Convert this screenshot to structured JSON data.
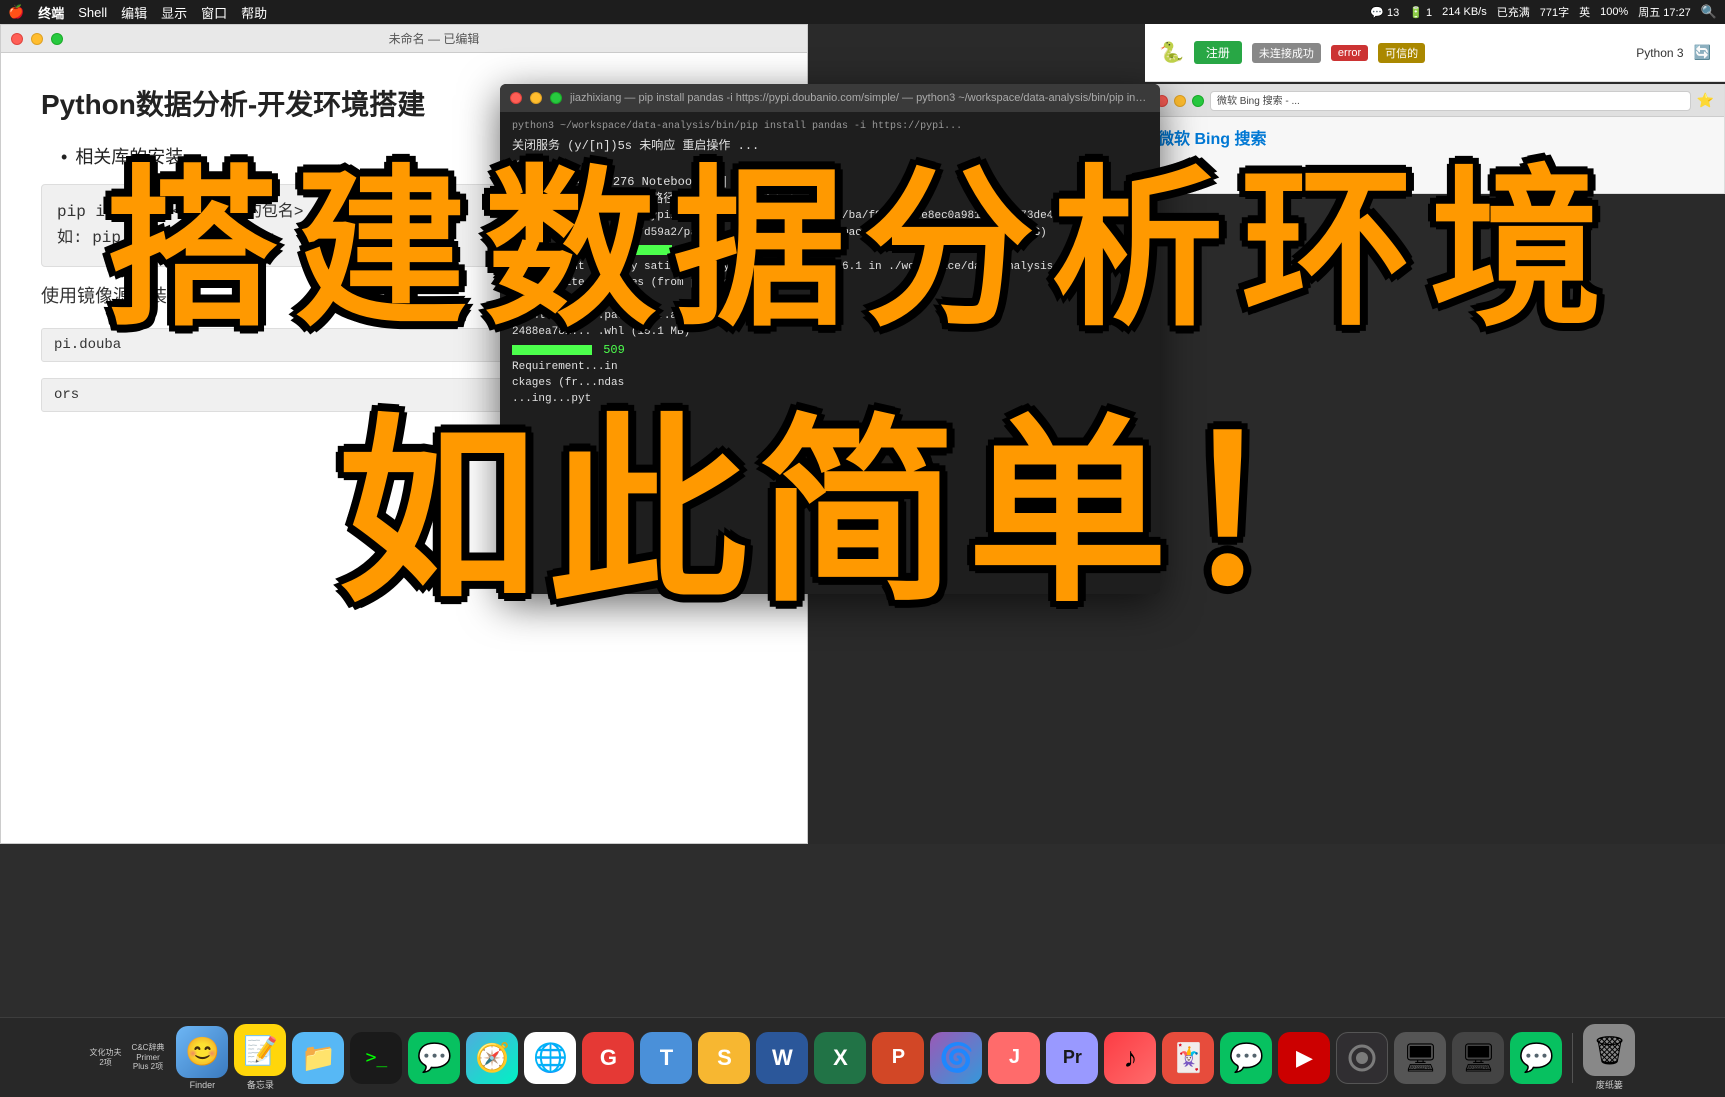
{
  "menubar": {
    "apple": "🍎",
    "items": [
      "终端",
      "Shell",
      "编辑",
      "显示",
      "窗口",
      "帮助"
    ],
    "right_items": [
      "📶 13",
      "🔋 1",
      "214 KB/s",
      "已充满",
      "771字",
      "英",
      "100% 🔋",
      "周五 17:27",
      "🔍"
    ]
  },
  "left_window": {
    "title": "未命名 — 已编辑",
    "slide": {
      "title": "Python数据分析-开发环境搭建",
      "bullet1": "相关库的安装",
      "code_line1": "pip install <你要安装的包名>",
      "code_line2": "如: pip install jupyter",
      "source_label": "使用镜像源安装：",
      "url1": "pi.douba",
      "url2": "ors"
    }
  },
  "terminal_window": {
    "title": "jiazhixiang — pip install pandas -i https://pypi.doubanio.com/simple/ — python3 ~/workspace/data-analysis/bin/pip install...",
    "subtitle": "python3 ~/workspace/data-analysis/bin/pip install pandas -i https://pypi...",
    "lines": [
      "关闭服务 (y/[n])5s 未响应 重启操作 ...",
      "y",
      "^C[1 17:24:52.276 NotebookApp] 中断",
      "启动 notebooks 在本地路径：/Users/jiazhixiang",
      "Downloading https://pypi.doubanio.com/packages/ab/ba/f97030b7e8ec0a981abdca173de4e72/b3a",
      "7b4ed5dba492f362ba87d59a2/pandas-1.0.1-cp37-cp37m-macosx_10_9_x86_64.whl (9.8 MB)",
      "[GREEN_BAR] 9.8 MB 596 kB/s",
      "Requirement already satisfied: python-dateutil>=2.6.1 in ./workspace/data-analysis/lib/pyt",
      "hon3.7/site-packages (from pandas) (2.8.1)",
      "Collecting...",
      "Downloading...package...a8d2c1e4a2cbf1",
      "2488ea781... .whl (15.1 MB)",
      "[GREEN_BAR2] 509",
      "Requirement...in",
      "ckages (fr...ndas",
      "...ing...pyt"
    ]
  },
  "overlay": {
    "top_text": "搭建数据分析环境",
    "bottom_text": "如此简单！"
  },
  "dock": {
    "items": [
      {
        "label": "文化功夫\n2项",
        "icon": "📝",
        "color": "#e8e8e8"
      },
      {
        "label": "C&C辞典 Primer\nPlus 2项",
        "icon": "📚",
        "color": "#e8e8e8"
      },
      {
        "label": "Finder",
        "icon": "😊",
        "color": "#6db6f5"
      },
      {
        "label": "备忘录",
        "icon": "📋",
        "color": "#ffd60a"
      },
      {
        "label": "Files",
        "icon": "📁",
        "color": "#57b8f5"
      },
      {
        "label": "Terminal",
        "icon": ">_",
        "color": "#1a1a1a"
      },
      {
        "label": "WeChat",
        "icon": "💬",
        "color": "#07c160"
      },
      {
        "label": "Safari",
        "icon": "🧭",
        "color": "#4facde"
      },
      {
        "label": "Chrome",
        "icon": "🔵",
        "color": "#4285f4"
      },
      {
        "label": "Grammarly",
        "icon": "G",
        "color": "#e53935"
      },
      {
        "label": "Typora",
        "icon": "T",
        "color": "#4a90d9"
      },
      {
        "label": "Sketch",
        "icon": "S",
        "color": "#f7b731"
      },
      {
        "label": "Word",
        "icon": "W",
        "color": "#2b579a"
      },
      {
        "label": "Excel",
        "icon": "X",
        "color": "#217346"
      },
      {
        "label": "PPT",
        "icon": "P",
        "color": "#d24726"
      },
      {
        "label": "macOS",
        "icon": "🌀",
        "color": "#9b59b6"
      },
      {
        "label": "JetBrains",
        "icon": "J",
        "color": "#ff6b6b"
      },
      {
        "label": "Premiere",
        "icon": "Pr",
        "color": "#9999ff"
      },
      {
        "label": "iTunes",
        "icon": "♪",
        "color": "#fc3c44"
      },
      {
        "label": "Solitaire",
        "icon": "🃏",
        "color": "#e74c3c"
      },
      {
        "label": "WeChat2",
        "icon": "💬",
        "color": "#07c160"
      },
      {
        "label": "Media",
        "icon": "▶",
        "color": "#e74c3c"
      },
      {
        "label": "OBS",
        "icon": "⬛",
        "color": "#302e31"
      },
      {
        "label": "Screen",
        "icon": "🖥",
        "color": "#555"
      },
      {
        "label": "Screen2",
        "icon": "🖥",
        "color": "#444"
      },
      {
        "label": "WeChat3",
        "icon": "💬",
        "color": "#07c160"
      },
      {
        "label": "Trash",
        "icon": "🗑",
        "color": "#888"
      }
    ]
  },
  "notebook_buttons": {
    "connect_label": "未连接成功",
    "error_label": "error",
    "warn_label": "可信的",
    "python_label": "Python 3"
  }
}
